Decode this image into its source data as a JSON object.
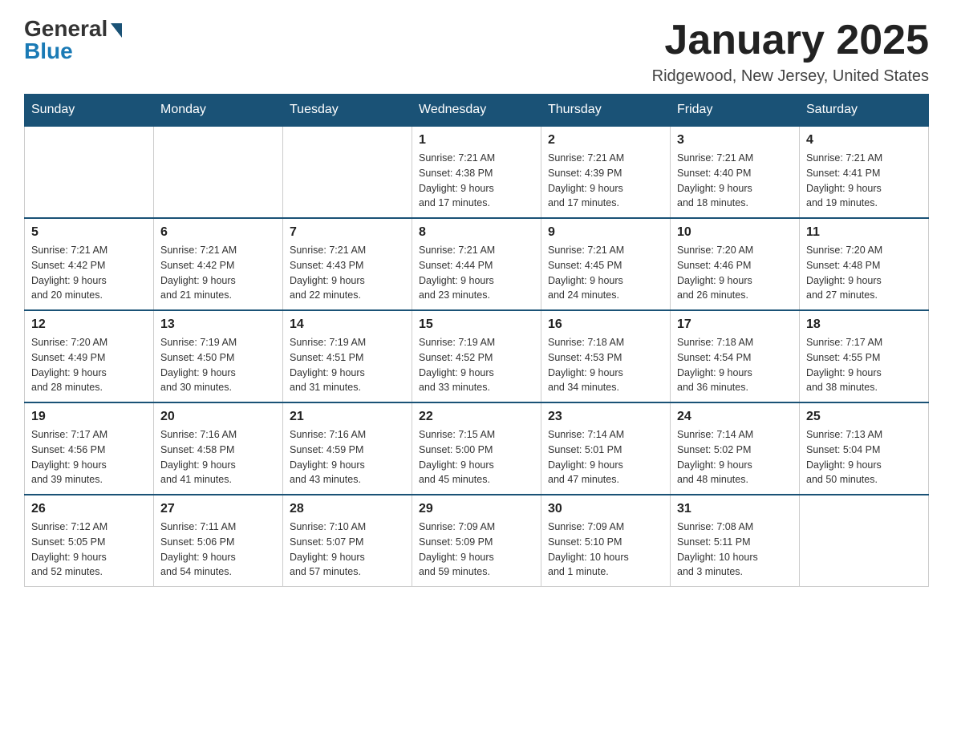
{
  "header": {
    "logo_general": "General",
    "logo_blue": "Blue",
    "month_title": "January 2025",
    "location": "Ridgewood, New Jersey, United States"
  },
  "days_of_week": [
    "Sunday",
    "Monday",
    "Tuesday",
    "Wednesday",
    "Thursday",
    "Friday",
    "Saturday"
  ],
  "weeks": [
    [
      {
        "day": "",
        "info": ""
      },
      {
        "day": "",
        "info": ""
      },
      {
        "day": "",
        "info": ""
      },
      {
        "day": "1",
        "info": "Sunrise: 7:21 AM\nSunset: 4:38 PM\nDaylight: 9 hours\nand 17 minutes."
      },
      {
        "day": "2",
        "info": "Sunrise: 7:21 AM\nSunset: 4:39 PM\nDaylight: 9 hours\nand 17 minutes."
      },
      {
        "day": "3",
        "info": "Sunrise: 7:21 AM\nSunset: 4:40 PM\nDaylight: 9 hours\nand 18 minutes."
      },
      {
        "day": "4",
        "info": "Sunrise: 7:21 AM\nSunset: 4:41 PM\nDaylight: 9 hours\nand 19 minutes."
      }
    ],
    [
      {
        "day": "5",
        "info": "Sunrise: 7:21 AM\nSunset: 4:42 PM\nDaylight: 9 hours\nand 20 minutes."
      },
      {
        "day": "6",
        "info": "Sunrise: 7:21 AM\nSunset: 4:42 PM\nDaylight: 9 hours\nand 21 minutes."
      },
      {
        "day": "7",
        "info": "Sunrise: 7:21 AM\nSunset: 4:43 PM\nDaylight: 9 hours\nand 22 minutes."
      },
      {
        "day": "8",
        "info": "Sunrise: 7:21 AM\nSunset: 4:44 PM\nDaylight: 9 hours\nand 23 minutes."
      },
      {
        "day": "9",
        "info": "Sunrise: 7:21 AM\nSunset: 4:45 PM\nDaylight: 9 hours\nand 24 minutes."
      },
      {
        "day": "10",
        "info": "Sunrise: 7:20 AM\nSunset: 4:46 PM\nDaylight: 9 hours\nand 26 minutes."
      },
      {
        "day": "11",
        "info": "Sunrise: 7:20 AM\nSunset: 4:48 PM\nDaylight: 9 hours\nand 27 minutes."
      }
    ],
    [
      {
        "day": "12",
        "info": "Sunrise: 7:20 AM\nSunset: 4:49 PM\nDaylight: 9 hours\nand 28 minutes."
      },
      {
        "day": "13",
        "info": "Sunrise: 7:19 AM\nSunset: 4:50 PM\nDaylight: 9 hours\nand 30 minutes."
      },
      {
        "day": "14",
        "info": "Sunrise: 7:19 AM\nSunset: 4:51 PM\nDaylight: 9 hours\nand 31 minutes."
      },
      {
        "day": "15",
        "info": "Sunrise: 7:19 AM\nSunset: 4:52 PM\nDaylight: 9 hours\nand 33 minutes."
      },
      {
        "day": "16",
        "info": "Sunrise: 7:18 AM\nSunset: 4:53 PM\nDaylight: 9 hours\nand 34 minutes."
      },
      {
        "day": "17",
        "info": "Sunrise: 7:18 AM\nSunset: 4:54 PM\nDaylight: 9 hours\nand 36 minutes."
      },
      {
        "day": "18",
        "info": "Sunrise: 7:17 AM\nSunset: 4:55 PM\nDaylight: 9 hours\nand 38 minutes."
      }
    ],
    [
      {
        "day": "19",
        "info": "Sunrise: 7:17 AM\nSunset: 4:56 PM\nDaylight: 9 hours\nand 39 minutes."
      },
      {
        "day": "20",
        "info": "Sunrise: 7:16 AM\nSunset: 4:58 PM\nDaylight: 9 hours\nand 41 minutes."
      },
      {
        "day": "21",
        "info": "Sunrise: 7:16 AM\nSunset: 4:59 PM\nDaylight: 9 hours\nand 43 minutes."
      },
      {
        "day": "22",
        "info": "Sunrise: 7:15 AM\nSunset: 5:00 PM\nDaylight: 9 hours\nand 45 minutes."
      },
      {
        "day": "23",
        "info": "Sunrise: 7:14 AM\nSunset: 5:01 PM\nDaylight: 9 hours\nand 47 minutes."
      },
      {
        "day": "24",
        "info": "Sunrise: 7:14 AM\nSunset: 5:02 PM\nDaylight: 9 hours\nand 48 minutes."
      },
      {
        "day": "25",
        "info": "Sunrise: 7:13 AM\nSunset: 5:04 PM\nDaylight: 9 hours\nand 50 minutes."
      }
    ],
    [
      {
        "day": "26",
        "info": "Sunrise: 7:12 AM\nSunset: 5:05 PM\nDaylight: 9 hours\nand 52 minutes."
      },
      {
        "day": "27",
        "info": "Sunrise: 7:11 AM\nSunset: 5:06 PM\nDaylight: 9 hours\nand 54 minutes."
      },
      {
        "day": "28",
        "info": "Sunrise: 7:10 AM\nSunset: 5:07 PM\nDaylight: 9 hours\nand 57 minutes."
      },
      {
        "day": "29",
        "info": "Sunrise: 7:09 AM\nSunset: 5:09 PM\nDaylight: 9 hours\nand 59 minutes."
      },
      {
        "day": "30",
        "info": "Sunrise: 7:09 AM\nSunset: 5:10 PM\nDaylight: 10 hours\nand 1 minute."
      },
      {
        "day": "31",
        "info": "Sunrise: 7:08 AM\nSunset: 5:11 PM\nDaylight: 10 hours\nand 3 minutes."
      },
      {
        "day": "",
        "info": ""
      }
    ]
  ]
}
